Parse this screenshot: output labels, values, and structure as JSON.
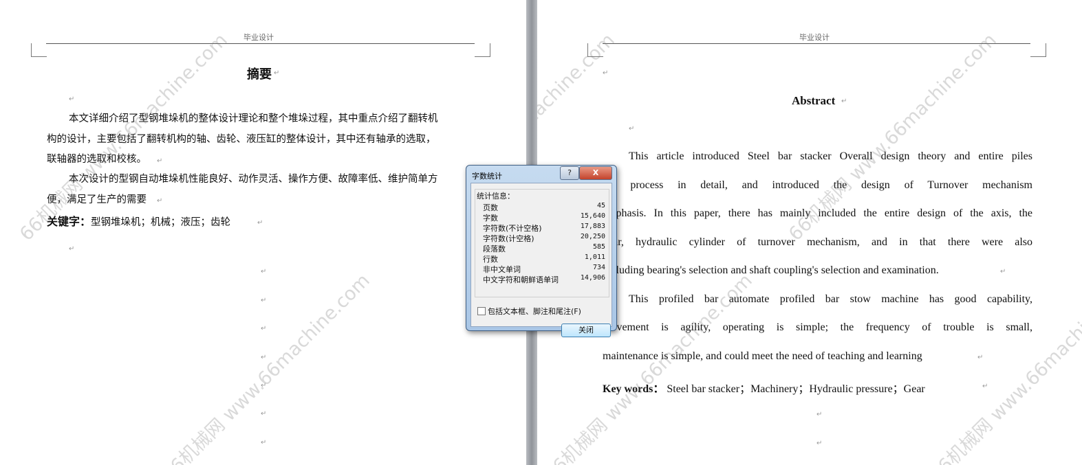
{
  "header": {
    "left": "毕业设计",
    "right": "毕业设计"
  },
  "para_mark": "↵",
  "left": {
    "title": "摘要",
    "para1_lines": [
      "本文详细介绍了型钢堆垛机的整体设计理论和整个堆垛过程，其中重点介绍了翻转机",
      "构的设计，主要包括了翻转机构的轴、齿轮、液压缸的整体设计，其中还有轴承的选取，",
      "联轴器的选取和校核。"
    ],
    "para2_lines": [
      "本次设计的型钢自动堆垛机性能良好、动作灵活、操作方便、故障率低、维护简单方",
      "便，满足了生产的需要"
    ],
    "keywords_label": "关键字：",
    "keywords": "型钢堆垛机；机械；液压；齿轮"
  },
  "right": {
    "title": "Abstract",
    "para1_lines": [
      "This article introduced Steel bar stacker Overall design theory and entire piles",
      "the process in detail, and introduced the design of Turnover mechanism",
      "emphasis. In this paper, there has mainly included the entire design of the axis, the",
      "gear, hydraulic cylinder of turnover mechanism, and in that there were also",
      "including bearing's selection and shaft coupling's selection and examination."
    ],
    "para2_lines": [
      "This profiled bar automate profiled bar stow machine has good capability,",
      "movement is agility, operating is simple; the frequency of trouble is small,",
      "maintenance is simple, and could meet the need of teaching and learning"
    ],
    "keywords_label": "Key words：",
    "keywords": "Steel bar stacker；Machinery；Hydraulic pressure；Gear"
  },
  "watermark": "66机械网 www.66machine.com",
  "dialog": {
    "title": "字数统计",
    "help_label": "?",
    "close_x": "X",
    "group_label": "统计信息：",
    "stats": [
      {
        "label": "页数",
        "value": "45"
      },
      {
        "label": "字数",
        "value": "15,640"
      },
      {
        "label": "字符数(不计空格)",
        "value": "17,883"
      },
      {
        "label": "字符数(计空格)",
        "value": "20,250"
      },
      {
        "label": "段落数",
        "value": "585"
      },
      {
        "label": "行数",
        "value": "1,011"
      },
      {
        "label": "非中文单词",
        "value": "734"
      },
      {
        "label": "中文字符和朝鲜语单词",
        "value": "14,906"
      }
    ],
    "checkbox_label": "包括文本框、脚注和尾注(F)",
    "close_button": "关闭"
  }
}
